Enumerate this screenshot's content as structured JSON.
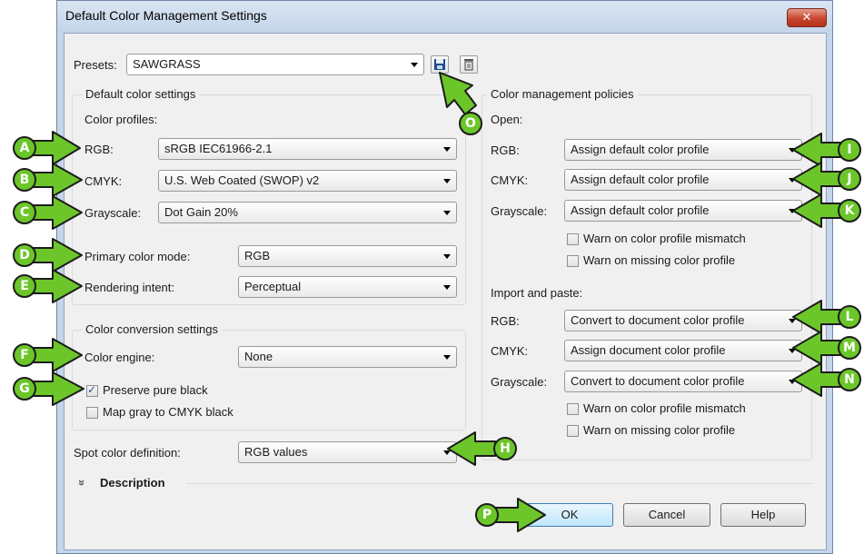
{
  "window": {
    "title": "Default Color Management Settings",
    "close_glyph": "✕"
  },
  "presets": {
    "label": "Presets:",
    "value": "SAWGRASS",
    "save_icon": "save-icon",
    "delete_icon": "trash-icon"
  },
  "default_color_settings": {
    "title": "Default color settings",
    "profiles_label": "Color profiles:",
    "rgb": {
      "label": "RGB:",
      "value": "sRGB IEC61966-2.1"
    },
    "cmyk": {
      "label": "CMYK:",
      "value": "U.S. Web Coated (SWOP) v2"
    },
    "grayscale": {
      "label": "Grayscale:",
      "value": "Dot Gain 20%"
    },
    "primary_mode": {
      "label": "Primary color mode:",
      "value": "RGB"
    },
    "rendering_intent": {
      "label": "Rendering intent:",
      "value": "Perceptual"
    }
  },
  "conversion": {
    "title": "Color conversion settings",
    "engine": {
      "label": "Color engine:",
      "value": "None"
    },
    "preserve_black": {
      "label": "Preserve pure black",
      "checked": true
    },
    "map_gray": {
      "label": "Map gray to CMYK black",
      "checked": false
    }
  },
  "spot": {
    "label": "Spot color definition:",
    "value": "RGB values"
  },
  "policies": {
    "title": "Color management policies",
    "open": {
      "label": "Open:",
      "rgb": {
        "label": "RGB:",
        "value": "Assign default color profile"
      },
      "cmyk": {
        "label": "CMYK:",
        "value": "Assign default color profile"
      },
      "grayscale": {
        "label": "Grayscale:",
        "value": "Assign default color profile"
      },
      "warn_mismatch": "Warn on color profile mismatch",
      "warn_missing": "Warn on missing color profile"
    },
    "import": {
      "label": "Import and paste:",
      "rgb": {
        "label": "RGB:",
        "value": "Convert to document color profile"
      },
      "cmyk": {
        "label": "CMYK:",
        "value": "Assign document color profile"
      },
      "grayscale": {
        "label": "Grayscale:",
        "value": "Convert to document color profile"
      },
      "warn_mismatch": "Warn on color profile mismatch",
      "warn_missing": "Warn on missing color profile"
    }
  },
  "description": {
    "toggle_glyph": "»",
    "label": "Description"
  },
  "buttons": {
    "ok": "OK",
    "cancel": "Cancel",
    "help": "Help"
  },
  "callouts": {
    "A": "A",
    "B": "B",
    "C": "C",
    "D": "D",
    "E": "E",
    "F": "F",
    "G": "G",
    "H": "H",
    "I": "I",
    "J": "J",
    "K": "K",
    "L": "L",
    "M": "M",
    "N": "N",
    "O": "O",
    "P": "P"
  },
  "colors": {
    "callout_fill": "#6cc62a",
    "callout_outline": "#1c1c1c",
    "default_button": "#bee6fd"
  }
}
